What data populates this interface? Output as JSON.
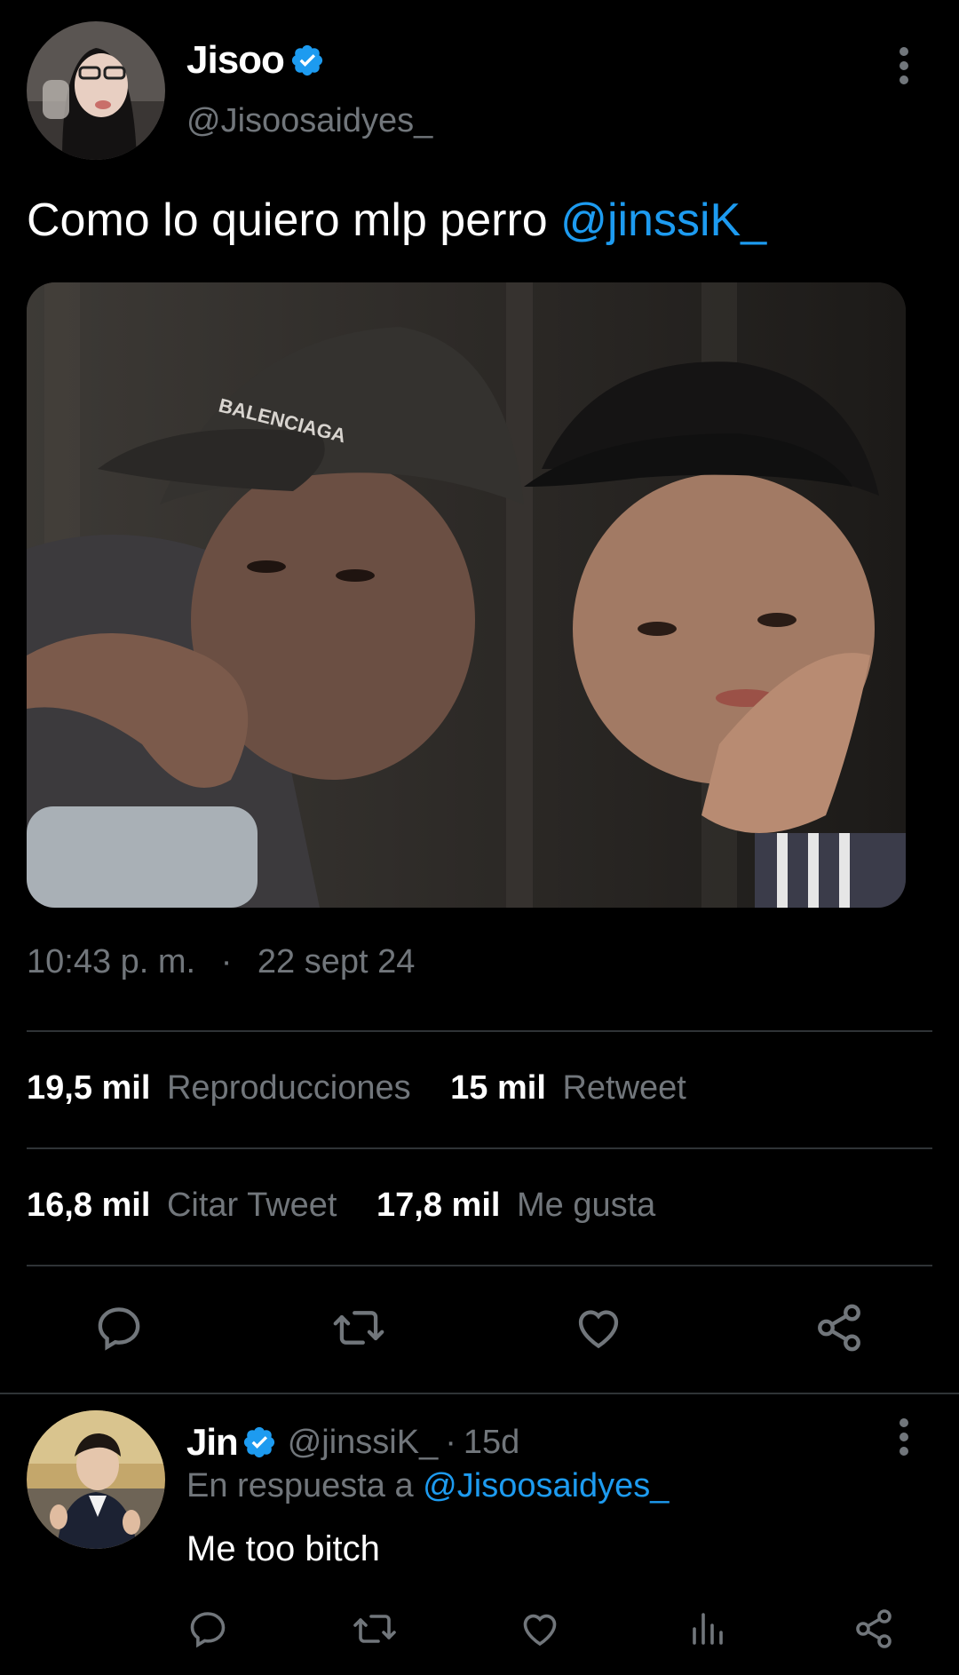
{
  "tweet": {
    "author_name": "Jisoo",
    "author_handle": "@Jisoosaidyes_",
    "text": "Como lo quiero mlp perro ",
    "mention": "@jinssiK_",
    "image_text": "BALENCIAGA",
    "time": "10:43 p. m.",
    "separator": "·",
    "date": "22 sept 24"
  },
  "stats": {
    "views_count": "19,5 mil",
    "views_label": "Reproducciones",
    "retweets_count": "15 mil",
    "retweets_label": "Retweet",
    "quotes_count": "16,8 mil",
    "quotes_label": "Citar Tweet",
    "likes_count": "17,8 mil",
    "likes_label": "Me gusta"
  },
  "actions": {
    "icons": [
      "reply-icon",
      "retweet-icon",
      "like-icon",
      "share-icon"
    ]
  },
  "reply": {
    "author_name": "Jin",
    "author_handle": "@jinssiK_",
    "dot": "·",
    "age": "15d",
    "in_reply_prefix": "En respuesta a ",
    "in_reply_handle": "@Jisoosaidyes_",
    "text": "Me too bitch",
    "icons": [
      "reply-icon",
      "retweet-icon",
      "like-icon",
      "views-icon",
      "share-icon"
    ]
  },
  "colors": {
    "background": "#000000",
    "accent": "#1d9bf0",
    "muted": "#71767b",
    "divider": "#2f3336"
  }
}
